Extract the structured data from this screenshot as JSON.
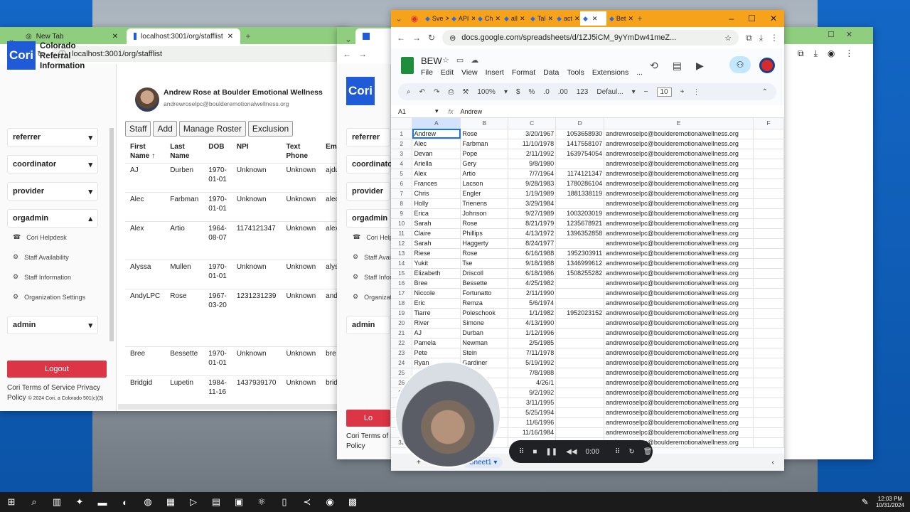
{
  "left_browser": {
    "tab1": "New Tab",
    "tab2": "localhost:3001/org/stafflist",
    "url": "localhost:3001/org/stafflist"
  },
  "app": {
    "logo": "Cori",
    "org_name": "Colorado Referral Information",
    "menus": [
      "referrer",
      "coordinator",
      "provider",
      "orgadmin",
      "admin"
    ],
    "submenu": [
      "Cori Helpdesk",
      "Staff Availability",
      "Staff Information",
      "Organization Settings"
    ],
    "user_title": "Andrew Rose at Boulder Emotional Wellness",
    "user_email": "andrewroselpc@boulderemotionalwellness.org",
    "buttons": [
      "Staff",
      "Add",
      "Manage Roster",
      "Exclusion"
    ],
    "logout": "Logout",
    "footer": "Cori Terms of Service Privacy Policy",
    "footer_small": "© 2024 Cori, a Colorado 501(c)(3)",
    "columns": [
      "First Name ↑",
      "Last Name",
      "DOB",
      "NPI",
      "Text Phone",
      "Em"
    ],
    "rows": [
      [
        "AJ",
        "Durben",
        "1970-01-01",
        "Unknown",
        "Unknown",
        "ajdu"
      ],
      [
        "Alec",
        "Farbman",
        "1970-01-01",
        "Unknown",
        "Unknown",
        "alec"
      ],
      [
        "Alex",
        "Artio",
        "1964-08-07",
        "1174121347",
        "Unknown",
        "alex"
      ],
      [
        "Alyssa",
        "Mullen",
        "1970-01-01",
        "Unknown",
        "Unknown",
        "alys"
      ],
      [
        "AndyLPC",
        "Rose",
        "1967-03-20",
        "1231231239",
        "Unknown",
        "and"
      ],
      [
        "Bree",
        "Bessette",
        "1970-01-01",
        "Unknown",
        "Unknown",
        "bre"
      ],
      [
        "Bridgid",
        "Lupetin",
        "1984-11-16",
        "1437939170",
        "Unknown",
        "brid"
      ]
    ]
  },
  "middle_app": {
    "submenu_partial": [
      "Cori Helpde",
      "Staff Avail",
      "Staff Infor",
      "Organizati"
    ],
    "footer_partial": "Cori Terms of Se",
    "policy_partial": "Policy",
    "logout_partial": "Lo"
  },
  "sheets": {
    "tabs": [
      "Sve",
      "API",
      "Ch",
      "all",
      "Tal",
      "act",
      "",
      "Bet"
    ],
    "url": "docs.google.com/spreadsheets/d/1ZJ5iCM_9yYmDw41meZ...",
    "doc_title": "BEW",
    "menus": [
      "File",
      "Edit",
      "View",
      "Insert",
      "Format",
      "Data",
      "Tools",
      "Extensions",
      "..."
    ],
    "toolbar": {
      "zoom": "100%",
      "currency": "$",
      "percent": "%",
      "dec_less": ".0",
      "dec_more": ".00",
      "format": "123",
      "font": "Defaul...",
      "size": "10"
    },
    "cell_ref": "A1",
    "formula": "Andrew",
    "sheet_tab": "Sheet1",
    "col_headers": [
      "",
      "A",
      "B",
      "C",
      "D",
      "E",
      "F"
    ],
    "rows": [
      [
        "Andrew",
        "Rose",
        "3/20/1967",
        "1053658930",
        "andrewroselpc@boulderemotionalwellness.org"
      ],
      [
        "Alec",
        "Farbman",
        "11/10/1978",
        "1417558107",
        "andrewroselpc@boulderemotionalwellness.org"
      ],
      [
        "Devan",
        "Pope",
        "2/11/1992",
        "1639754054",
        "andrewroselpc@boulderemotionalwellness.org"
      ],
      [
        "Ariella",
        "Gery",
        "9/8/1980",
        "",
        "andrewroselpc@boulderemotionalwellness.org"
      ],
      [
        "Alex",
        "Artio",
        "7/7/1964",
        "1174121347",
        "andrewroselpc@boulderemotionalwellness.org"
      ],
      [
        "Frances",
        "Lacson",
        "9/28/1983",
        "1780286104",
        "andrewroselpc@boulderemotionalwellness.org"
      ],
      [
        "Chris",
        "Engler",
        "1/19/1989",
        "1881338119",
        "andrewroselpc@boulderemotionalwellness.org"
      ],
      [
        "Holly",
        "Trienens",
        "3/29/1984",
        "",
        "andrewroselpc@boulderemotionalwellness.org"
      ],
      [
        "Erica",
        "Johnson",
        "9/27/1989",
        "1003203019",
        "andrewroselpc@boulderemotionalwellness.org"
      ],
      [
        "Sarah",
        "Rose",
        "8/21/1979",
        "1235678921",
        "andrewroselpc@boulderemotionalwellness.org"
      ],
      [
        "Claire",
        "Phillips",
        "4/13/1972",
        "1396352858",
        "andrewroselpc@boulderemotionalwellness.org"
      ],
      [
        "Sarah",
        "Haggerty",
        "8/24/1977",
        "",
        "andrewroselpc@boulderemotionalwellness.org"
      ],
      [
        "Riese",
        "Rose",
        "6/16/1988",
        "1952303911",
        "andrewroselpc@boulderemotionalwellness.org"
      ],
      [
        "Yukit",
        "Tse",
        "9/18/1988",
        "1346999612",
        "andrewroselpc@boulderemotionalwellness.org"
      ],
      [
        "Elizabeth",
        "Driscoll",
        "6/18/1986",
        "1508255282",
        "andrewroselpc@boulderemotionalwellness.org"
      ],
      [
        "Bree",
        "Bessette",
        "4/25/1982",
        "",
        "andrewroselpc@boulderemotionalwellness.org"
      ],
      [
        "Niccole",
        "Fortunatto",
        "2/11/1990",
        "",
        "andrewroselpc@boulderemotionalwellness.org"
      ],
      [
        "Eric",
        "Remza",
        "5/6/1974",
        "",
        "andrewroselpc@boulderemotionalwellness.org"
      ],
      [
        "Tiarre",
        "Poleschook",
        "1/1/1982",
        "1952023152",
        "andrewroselpc@boulderemotionalwellness.org"
      ],
      [
        "River",
        "Simone",
        "4/13/1990",
        "",
        "andrewroselpc@boulderemotionalwellness.org"
      ],
      [
        "AJ",
        "Durban",
        "1/12/1996",
        "",
        "andrewroselpc@boulderemotionalwellness.org"
      ],
      [
        "Pamela",
        "Newman",
        "2/5/1985",
        "",
        "andrewroselpc@boulderemotionalwellness.org"
      ],
      [
        "Pete",
        "Stein",
        "7/11/1978",
        "",
        "andrewroselpc@boulderemotionalwellness.org"
      ],
      [
        "Ryan",
        "Gardiner",
        "5/19/1992",
        "",
        "andrewroselpc@boulderemotionalwellness.org"
      ],
      [
        "",
        "",
        "7/8/1988",
        "",
        "andrewroselpc@boulderemotionalwellness.org"
      ],
      [
        "",
        "",
        "4/26/1",
        "",
        "andrewroselpc@boulderemotionalwellness.org"
      ],
      [
        "",
        "",
        "9/2/1992",
        "",
        "andrewroselpc@boulderemotionalwellness.org"
      ],
      [
        "",
        "",
        "3/11/1995",
        "",
        "andrewroselpc@boulderemotionalwellness.org"
      ],
      [
        "",
        "",
        "5/25/1994",
        "",
        "andrewroselpc@boulderemotionalwellness.org"
      ],
      [
        "",
        "",
        "11/6/1996",
        "",
        "andrewroselpc@boulderemotionalwellness.org"
      ],
      [
        "",
        "",
        "11/16/1984",
        "",
        "andrewroselpc@boulderemotionalwellness.org"
      ],
      [
        "",
        "e",
        "",
        "",
        "andrewroselpc@boulderemotionalwellness.org"
      ]
    ]
  },
  "recorder": {
    "time": "0:00"
  },
  "taskbar": {
    "time": "12:03 PM",
    "date": "10/31/2024"
  }
}
